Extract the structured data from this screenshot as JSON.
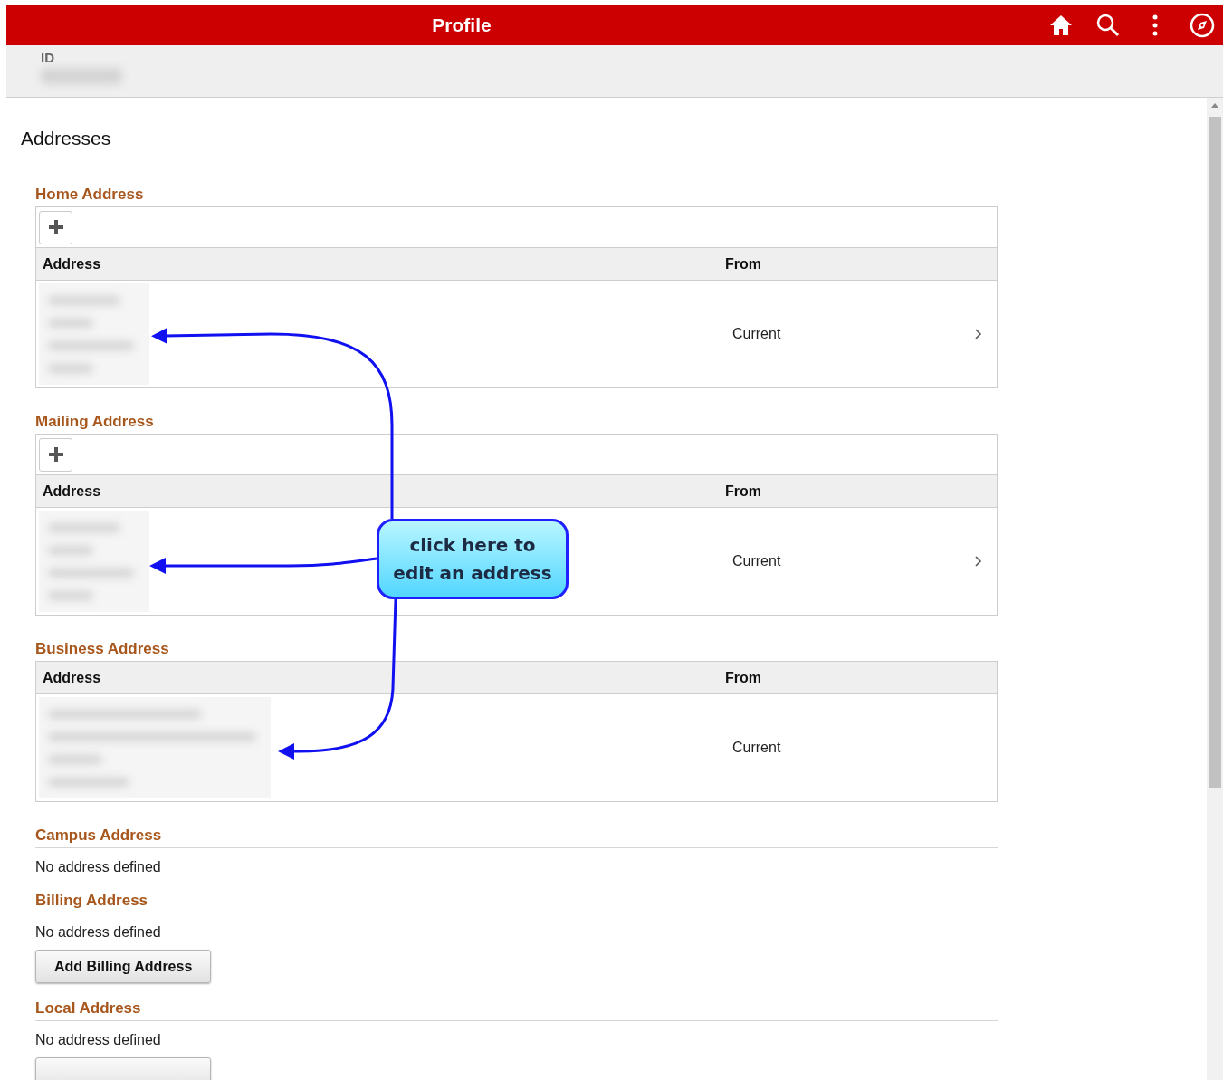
{
  "header": {
    "title": "Profile"
  },
  "id_bar": {
    "label": "ID"
  },
  "page_title": "Addresses",
  "sections": [
    {
      "kind": "table",
      "title": "Home Address",
      "add_button": true,
      "columns": [
        "Address",
        "From"
      ],
      "rows": [
        {
          "kind": "narrow",
          "from": "Current",
          "chevron": true
        }
      ]
    },
    {
      "kind": "table",
      "title": "Mailing Address",
      "add_button": true,
      "columns": [
        "Address",
        "From"
      ],
      "rows": [
        {
          "kind": "narrow",
          "from": "Current",
          "chevron": true
        }
      ]
    },
    {
      "kind": "table",
      "title": "Business Address",
      "add_button": false,
      "columns": [
        "Address",
        "From"
      ],
      "rows": [
        {
          "kind": "wide",
          "from": "Current",
          "chevron": false
        }
      ]
    },
    {
      "kind": "empty",
      "title": "Campus Address",
      "message": "No address defined"
    },
    {
      "kind": "empty",
      "title": "Billing Address",
      "message": "No address defined",
      "button": {
        "label": "Add Billing Address"
      }
    },
    {
      "kind": "empty",
      "title": "Local Address",
      "message": "No address defined",
      "blank_button": true
    }
  ],
  "callout": {
    "lines": [
      "click here to",
      "edit an address"
    ]
  }
}
